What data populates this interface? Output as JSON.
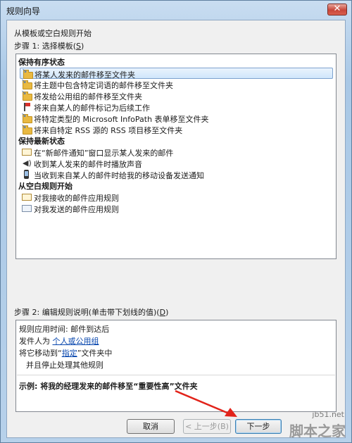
{
  "window": {
    "title": "规则向导",
    "close_label": "✕"
  },
  "header": {
    "intro": "从模板或空白规则开始",
    "step1_prefix": "步骤 1: 选择模板(",
    "step1_key": "S",
    "step1_suffix": ")"
  },
  "templates": {
    "groups": [
      {
        "label": "保持有序状态",
        "items": [
          {
            "label": "将某人发来的邮件移至文件夹",
            "icon": "folder-icon",
            "selected": true
          },
          {
            "label": "将主题中包含特定词语的邮件移至文件夹",
            "icon": "folder-icon"
          },
          {
            "label": "将发给公用组的邮件移至文件夹",
            "icon": "folder-icon"
          },
          {
            "label": "将来自某人的邮件标记为后续工作",
            "icon": "flag-icon"
          },
          {
            "label": "将特定类型的 Microsoft InfoPath 表单移至文件夹",
            "icon": "folder-icon"
          },
          {
            "label": "将来自特定 RSS 源的 RSS 项目移至文件夹",
            "icon": "folder-icon"
          }
        ]
      },
      {
        "label": "保持最新状态",
        "items": [
          {
            "label": "在“新邮件通知”窗口显示某人发来的邮件",
            "icon": "envelope-icon"
          },
          {
            "label": "收到某人发来的邮件时播放声音",
            "icon": "speaker-icon"
          },
          {
            "label": "当收到来自某人的邮件时给我的移动设备发送通知",
            "icon": "mobile-icon"
          }
        ]
      },
      {
        "label": "从空白规则开始",
        "items": [
          {
            "label": "对我接收的邮件应用规则",
            "icon": "envelope-icon"
          },
          {
            "label": "对我发送的邮件应用规则",
            "icon": "sent-envelope-icon"
          }
        ]
      }
    ]
  },
  "step2": {
    "prefix": "步骤 2: 编辑规则说明(单击带下划线的值)(",
    "key": "D",
    "suffix": ")"
  },
  "description": {
    "line1": "规则应用时间: 邮件到达后",
    "line2_prefix": "发件人为 ",
    "line2_link": "个人或公用组",
    "line3_prefix": "将它移动到“",
    "line3_link": "指定",
    "line3_suffix": "”文件夹中",
    "line4": "并且停止处理其他规则",
    "example": "示例: 将我的经理发来的邮件移至“重要性高”文件夹"
  },
  "buttons": {
    "cancel": "取消",
    "back": "< 上一步(B)",
    "next": "下一步"
  },
  "watermark": {
    "url": "jb51.net",
    "text": "脚本之家"
  },
  "colors": {
    "selection": "#cfe6fb",
    "link": "#0645ad",
    "annotation_arrow": "#e2231a"
  }
}
